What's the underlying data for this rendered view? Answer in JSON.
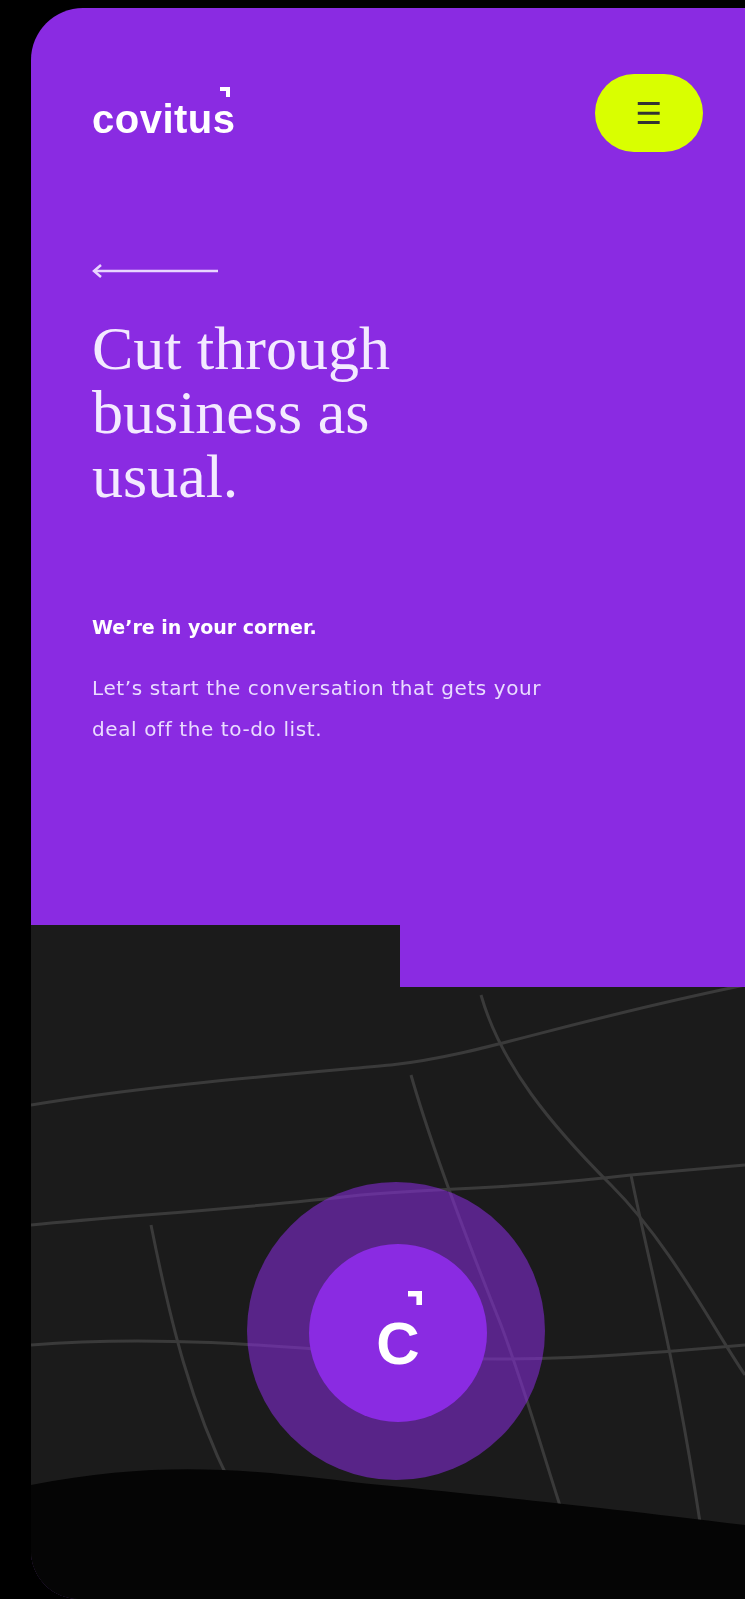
{
  "header": {
    "logo": "covitus",
    "menu_button": "☰"
  },
  "hero": {
    "title": "Cut through business as usual.",
    "subtitle": "We’re in your corner.",
    "body": "Let’s start the conversation that gets your deal off the to-do list."
  },
  "map": {
    "marker": "C"
  }
}
